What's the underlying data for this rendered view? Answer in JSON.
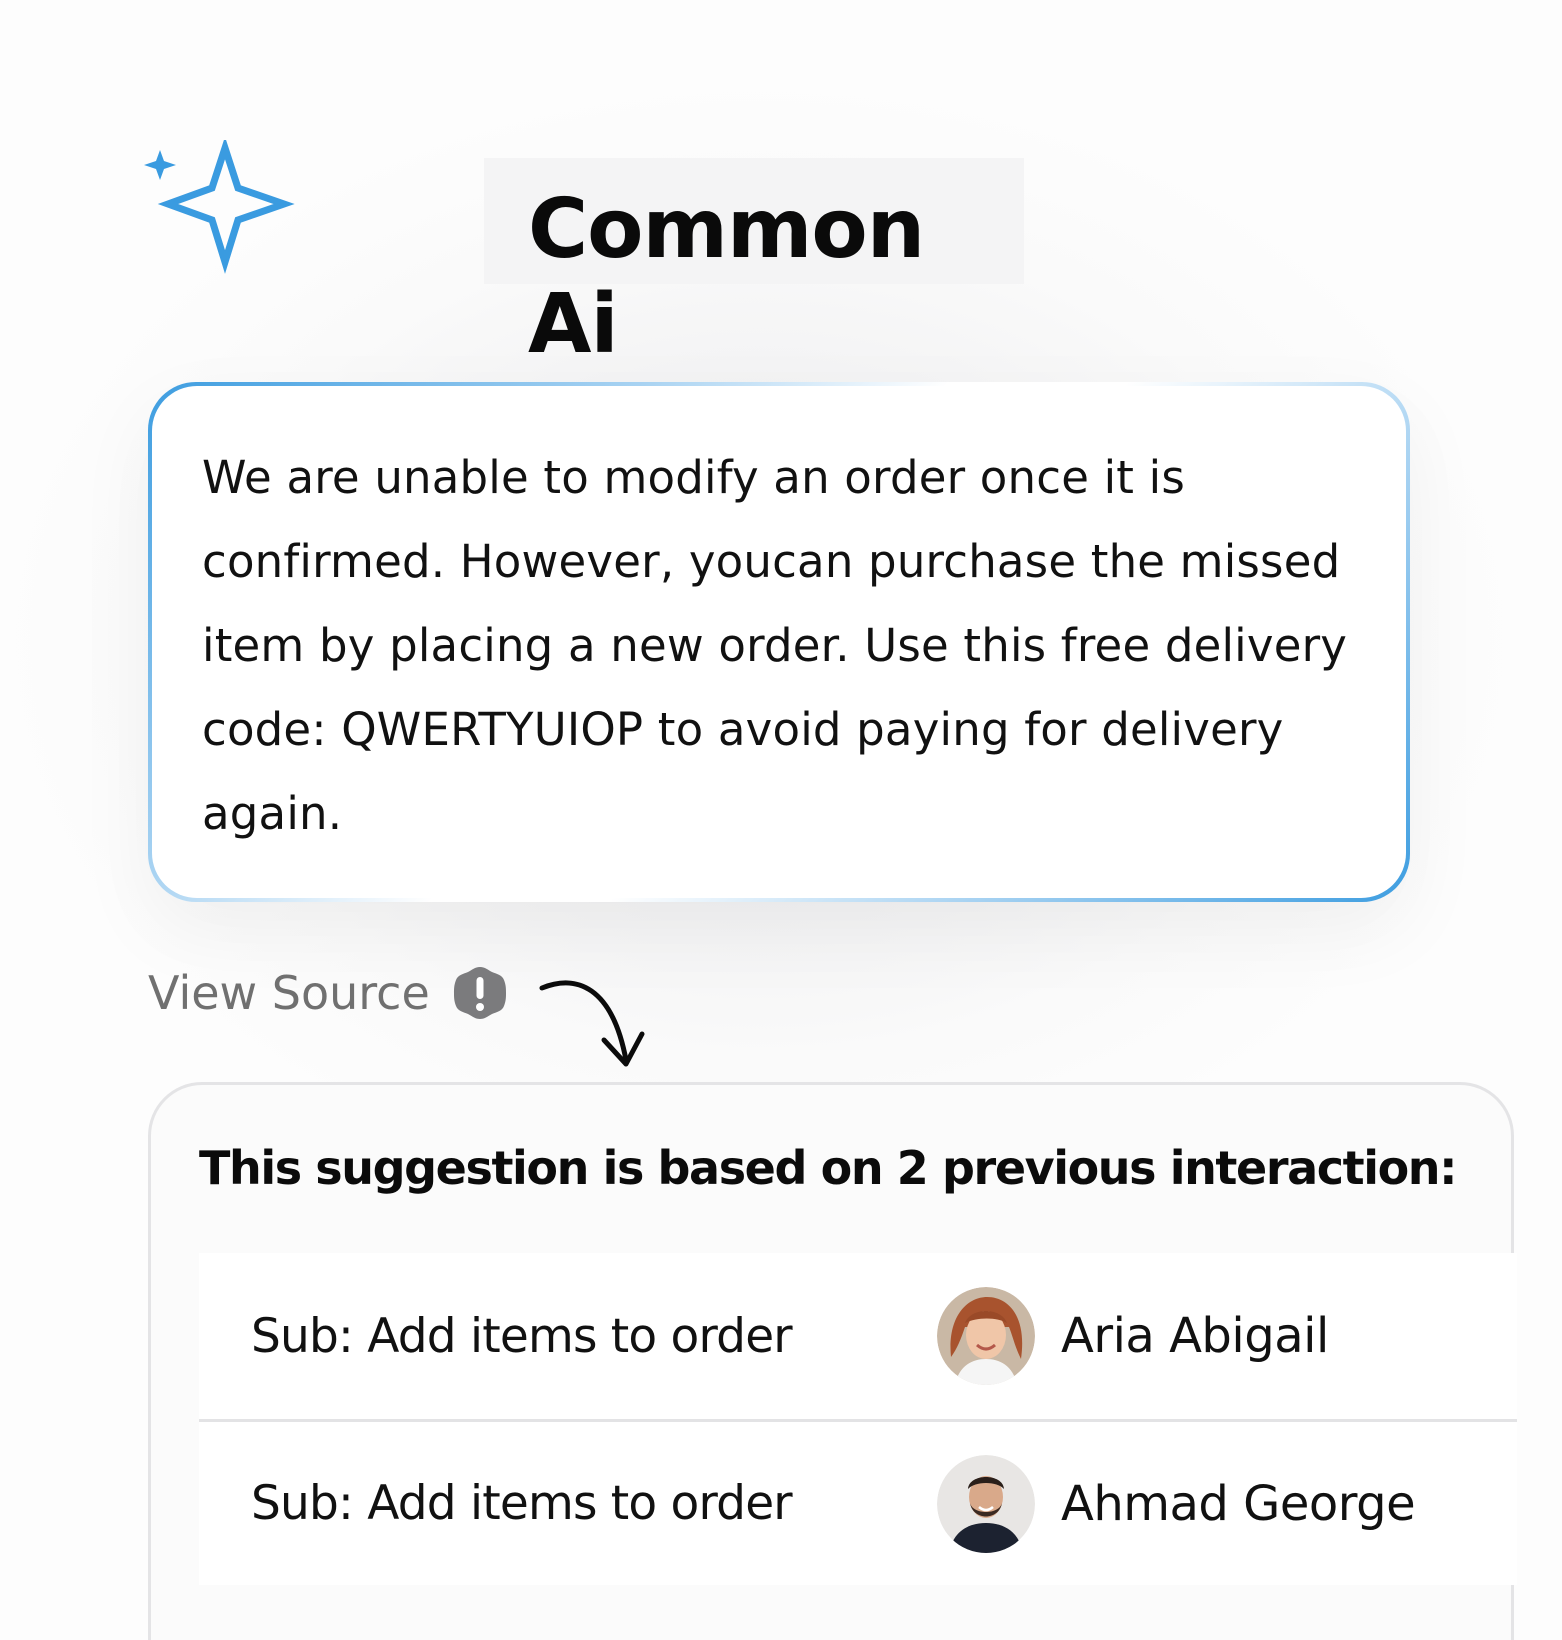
{
  "header": {
    "title": "Common Ai",
    "logo_icon": "sparkle-icon",
    "accent_color": "#3A9BE0"
  },
  "message": {
    "text": "We are unable to modify an order once it is confirmed. However, youcan purchase the missed item by placing a new order. Use this free delivery code: QWERTYUIOP to avoid paying for delivery again."
  },
  "view_source": {
    "label": "View Source",
    "icon": "info-icon",
    "arrow_icon": "curved-arrow-icon"
  },
  "source_panel": {
    "heading": "This suggestion is based on 2 previous interaction:",
    "interactions": [
      {
        "subject": "Sub: Add items to order",
        "name": "Aria Abigail",
        "avatar": "avatar-female"
      },
      {
        "subject": "Sub: Add items to order",
        "name": "Ahmad George",
        "avatar": "avatar-male"
      }
    ]
  }
}
